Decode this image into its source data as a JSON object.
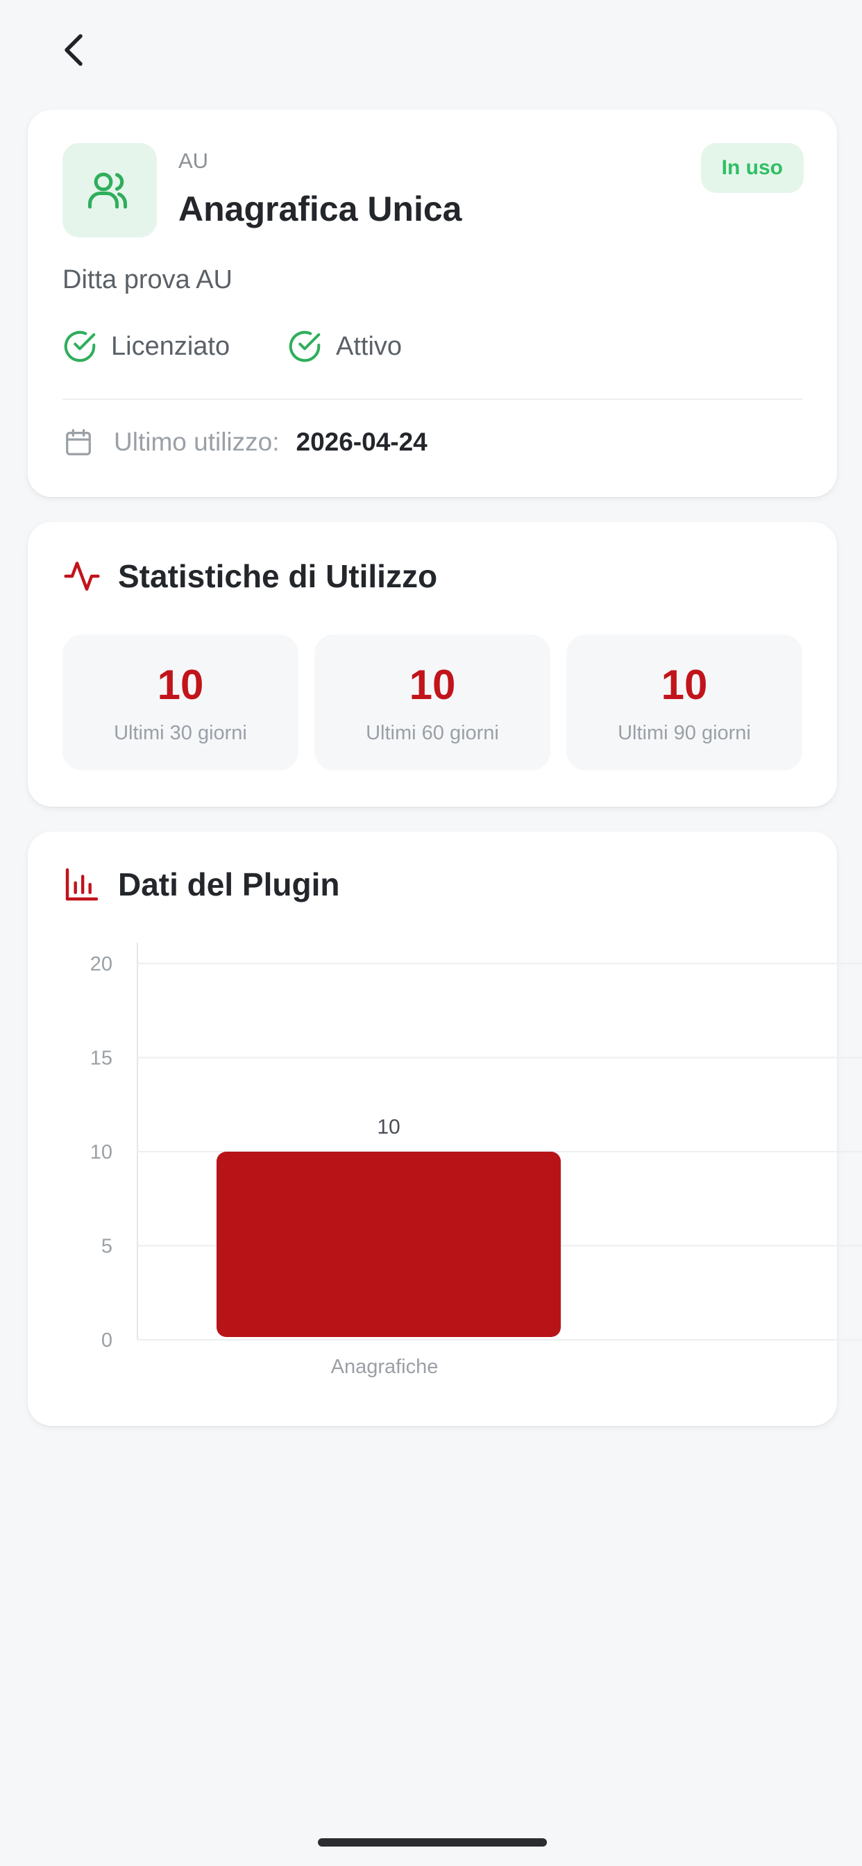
{
  "colors": {
    "accent": "#c1141b",
    "success": "#2fbf63",
    "background": "#f6f7f9"
  },
  "header": {
    "back_icon": "chevron-left-icon"
  },
  "plugin": {
    "icon": "users-icon",
    "code": "AU",
    "name": "Anagrafica Unica",
    "status_badge": "In uso",
    "company": "Ditta prova AU",
    "flags": {
      "licensed": "Licenziato",
      "active": "Attivo"
    },
    "last_use_label": "Ultimo utilizzo:",
    "last_use_value": "2026-04-24"
  },
  "stats": {
    "title": "Statistiche di Utilizzo",
    "icon": "activity-icon",
    "items": [
      {
        "value": "10",
        "label": "Ultimi 30 giorni"
      },
      {
        "value": "10",
        "label": "Ultimi 60 giorni"
      },
      {
        "value": "10",
        "label": "Ultimi 90 giorni"
      }
    ]
  },
  "plugin_data": {
    "title": "Dati del Plugin",
    "icon": "bar-chart-icon"
  },
  "chart_data": {
    "type": "bar",
    "categories": [
      "Anagrafiche"
    ],
    "values": [
      10
    ],
    "ylim": [
      0,
      20
    ],
    "yticks": [
      0,
      5,
      10,
      15,
      20
    ],
    "grid": true,
    "color": "#b81417"
  }
}
